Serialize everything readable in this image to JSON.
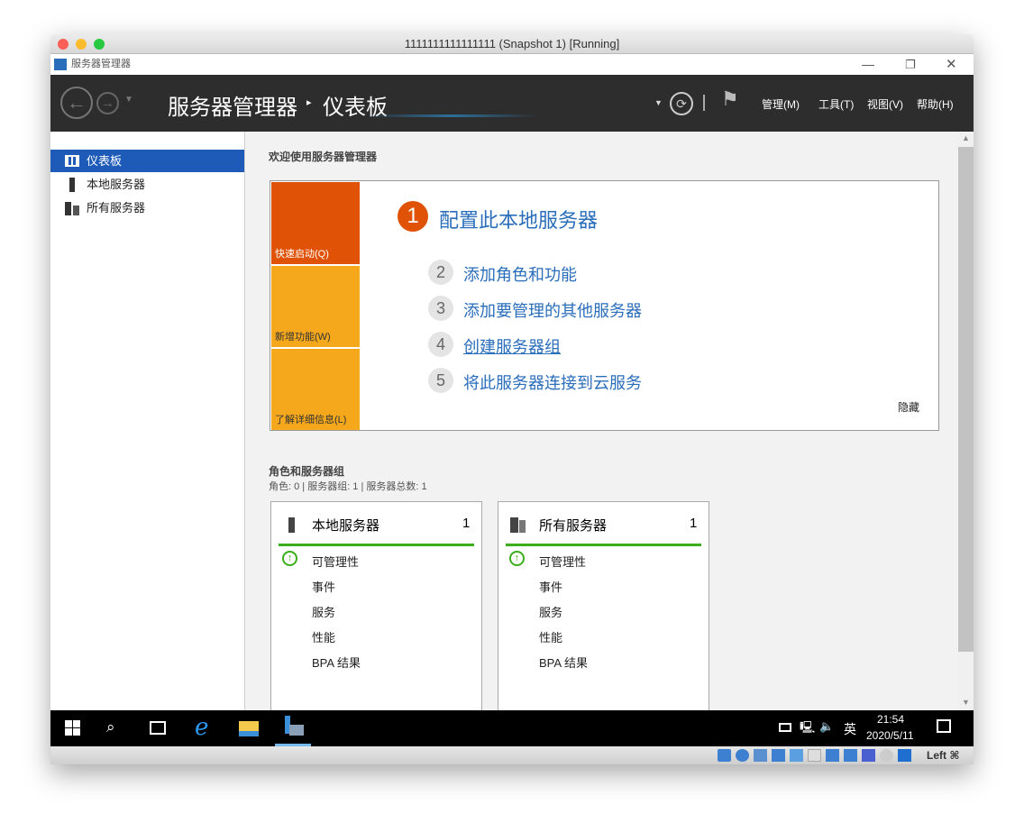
{
  "vm_title": "1111111111111111 (Snapshot 1) [Running]",
  "window_title": "服务器管理器",
  "header": {
    "app": "服务器管理器",
    "separator": "▸",
    "page": "仪表板",
    "menus": [
      "管理(M)",
      "工具(T)",
      "视图(V)",
      "帮助(H)"
    ]
  },
  "sidebar": {
    "items": [
      {
        "label": "仪表板"
      },
      {
        "label": "本地服务器"
      },
      {
        "label": "所有服务器"
      }
    ]
  },
  "welcome": {
    "title": "欢迎使用服务器管理器",
    "tiles": [
      "快速启动(Q)",
      "新增功能(W)",
      "了解详细信息(L)"
    ],
    "steps": [
      {
        "n": "1",
        "label": "配置此本地服务器"
      },
      {
        "n": "2",
        "label": "添加角色和功能"
      },
      {
        "n": "3",
        "label": "添加要管理的其他服务器"
      },
      {
        "n": "4",
        "label": "创建服务器组"
      },
      {
        "n": "5",
        "label": "将此服务器连接到云服务"
      }
    ],
    "hide": "隐藏"
  },
  "roles": {
    "title": "角色和服务器组",
    "summary": "角色: 0 | 服务器组: 1 | 服务器总数: 1",
    "cards": [
      {
        "title": "本地服务器",
        "count": "1",
        "items": [
          "可管理性",
          "事件",
          "服务",
          "性能",
          "BPA 结果"
        ]
      },
      {
        "title": "所有服务器",
        "count": "1",
        "items": [
          "可管理性",
          "事件",
          "服务",
          "性能",
          "BPA 结果"
        ]
      }
    ]
  },
  "taskbar": {
    "time": "21:54",
    "date": "2020/5/11",
    "ime": "英"
  },
  "vbox": {
    "hostkey": "Left ⌘"
  },
  "colors": {
    "accent": "#1e5bb8",
    "orange": "#e05206",
    "yellow": "#f5a81c",
    "green": "#3aae1b",
    "link": "#2a6ebb"
  }
}
